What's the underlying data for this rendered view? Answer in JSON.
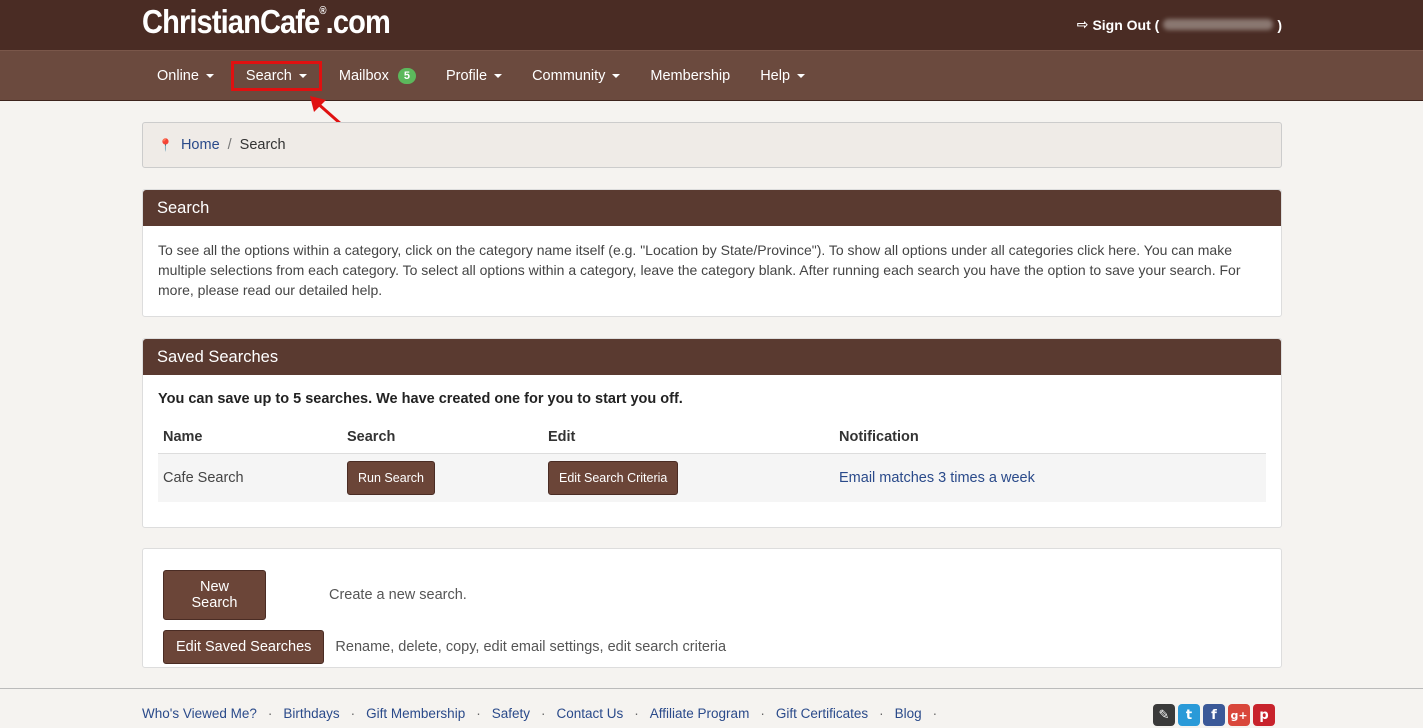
{
  "header": {
    "logo_text": "ChristianCafe",
    "logo_suffix": ".com",
    "logo_reg": "®",
    "signout_label": "Sign Out (",
    "signout_close": ")"
  },
  "nav": {
    "items": [
      {
        "label": "Online",
        "caret": true
      },
      {
        "label": "Search",
        "caret": true
      },
      {
        "label": "Mailbox",
        "badge": "5"
      },
      {
        "label": "Profile",
        "caret": true
      },
      {
        "label": "Community",
        "caret": true
      },
      {
        "label": "Membership"
      },
      {
        "label": "Help",
        "caret": true
      }
    ]
  },
  "breadcrumb": {
    "home": "Home",
    "separator": "/",
    "current": "Search"
  },
  "search_panel": {
    "title": "Search",
    "body": "To see all the options within a category, click on the category name itself (e.g. \"Location by State/Province\"). To show all options under all categories click here. You can make multiple selections from each category. To select all options within a category, leave the category blank. After running each search you have the option to save your search. For more, please read our detailed help."
  },
  "saved_panel": {
    "title": "Saved Searches",
    "intro": "You can save up to 5 searches. We have created one for you to start you off.",
    "columns": [
      "Name",
      "Search",
      "Edit",
      "Notification"
    ],
    "rows": [
      {
        "name": "Cafe Search",
        "search_btn": "Run Search",
        "edit_btn": "Edit Search Criteria",
        "notification": "Email matches 3 times a week"
      }
    ]
  },
  "actions": {
    "new_label": "New Search",
    "new_desc": "Create a new search.",
    "edit_label": "Edit Saved Searches",
    "edit_desc": "Rename, delete, copy, edit email settings, edit search criteria"
  },
  "footer": {
    "links": [
      "Who's Viewed Me?",
      "Birthdays",
      "Gift Membership",
      "Safety",
      "Contact Us",
      "Affiliate Program",
      "Gift Certificates",
      "Blog"
    ],
    "separator": "·"
  },
  "social": {
    "icons": [
      "pencil-icon",
      "twitter-icon",
      "facebook-icon",
      "google-plus-icon",
      "pinterest-icon"
    ],
    "colors": [
      "#3a3a3a",
      "#2a9ad8",
      "#3b5998",
      "#d9473b",
      "#c8232c"
    ]
  },
  "colors": {
    "topbar": "#4a2c24",
    "navbar": "#6b4a3e",
    "panel_head": "#5a3a30",
    "button": "#6b4538",
    "link": "#2a4a8a",
    "badge": "#5cb85c",
    "highlight": "#e01010"
  }
}
